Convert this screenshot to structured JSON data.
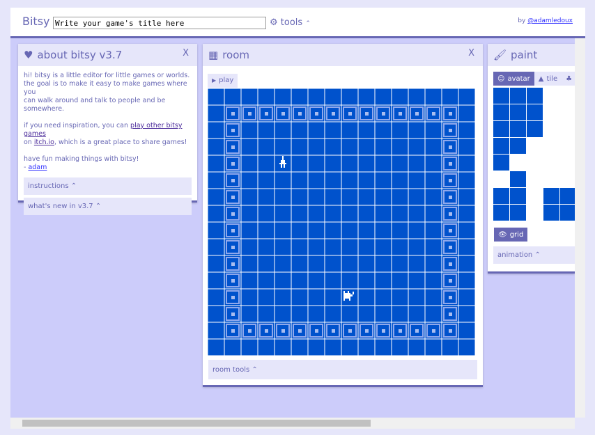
{
  "header": {
    "logo": "Bitsy",
    "title_value": "Write your game's title here",
    "tools_label": "tools",
    "by_label": "by",
    "by_link": "@adamledoux"
  },
  "about": {
    "title": "about bitsy v3.7",
    "close": "X",
    "p1": "hi! bitsy is a little editor for little games or worlds.",
    "p2": "the goal is to make it easy to make games where you",
    "p3": "can walk around and talk to people and be somewhere.",
    "p4a": "if you need inspiration, you can ",
    "p4link": "play other bitsy games",
    "p5a": "on ",
    "p5link": "itch.io",
    "p5b": ", which is a great place to share games!",
    "p6": "have fun making things with bitsy!",
    "p7a": "- ",
    "p7link": "adam",
    "instructions": "instructions",
    "whats_new": "what's new in v3.7"
  },
  "room": {
    "title": "room",
    "close": "X",
    "play": "play",
    "room_tools": "room tools"
  },
  "paint": {
    "title": "paint",
    "tabs": [
      "avatar",
      "tile",
      "sprite"
    ],
    "grid": "grid",
    "animation": "animation"
  },
  "colors": {
    "bg": "#0052cc",
    "fg": "#ffffff",
    "ui": "#6767b4"
  }
}
